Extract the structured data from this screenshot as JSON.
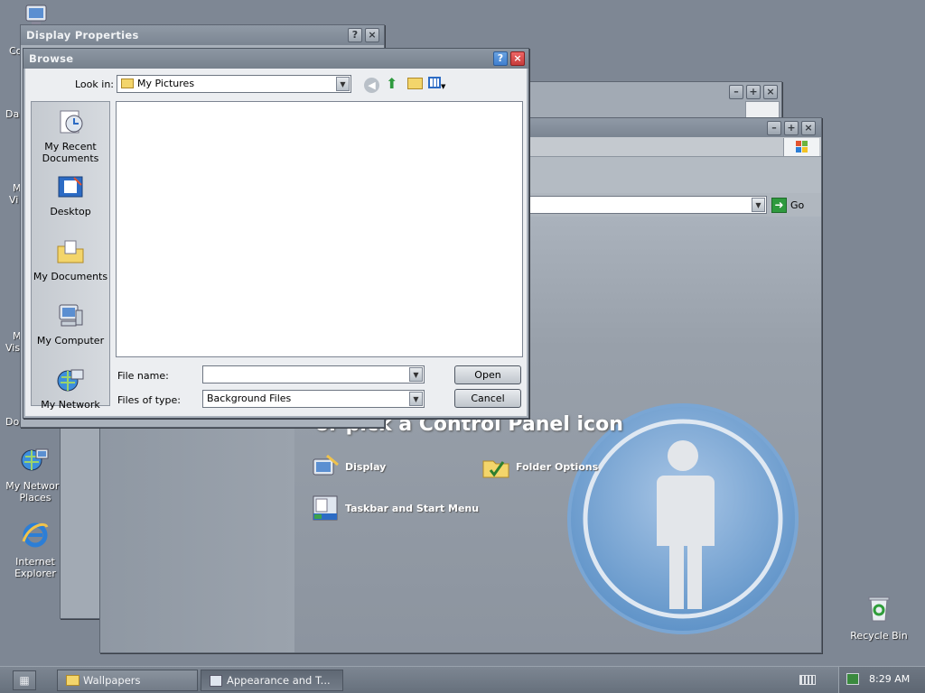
{
  "desktop": {
    "icons": [
      {
        "label": "My Network Places"
      },
      {
        "label": "Internet Explorer"
      },
      {
        "label": "Recycle Bin"
      }
    ],
    "cut_labels": [
      "Co",
      "Da",
      "M",
      "Vi",
      "M",
      "Vis",
      "Do"
    ]
  },
  "display_properties": {
    "title": "Display Properties"
  },
  "control_panel": {
    "heading": "or pick a Control Panel icon",
    "go_label": "Go",
    "tasks": [
      {
        "label": "Display"
      },
      {
        "label": "Folder Options"
      },
      {
        "label": "Taskbar and Start Menu"
      }
    ]
  },
  "browse": {
    "title": "Browse",
    "look_in_label": "Look in:",
    "look_in_value": "My Pictures",
    "places": [
      {
        "label": "My Recent Documents"
      },
      {
        "label": "Desktop"
      },
      {
        "label": "My Documents"
      },
      {
        "label": "My Computer"
      },
      {
        "label": "My Network"
      }
    ],
    "file_name_label": "File name:",
    "file_name_value": "",
    "files_of_type_label": "Files of type:",
    "files_of_type_value": "Background Files",
    "open_label": "Open",
    "cancel_label": "Cancel"
  },
  "taskbar": {
    "buttons": [
      {
        "label": "Wallpapers"
      },
      {
        "label": "Appearance and T..."
      }
    ],
    "clock": "8:29 AM"
  },
  "colors": {
    "accent": "#6fa0d2",
    "close": "#c63b3b",
    "help": "#3f7fd0",
    "go_arrow": "#2e9a3e"
  }
}
